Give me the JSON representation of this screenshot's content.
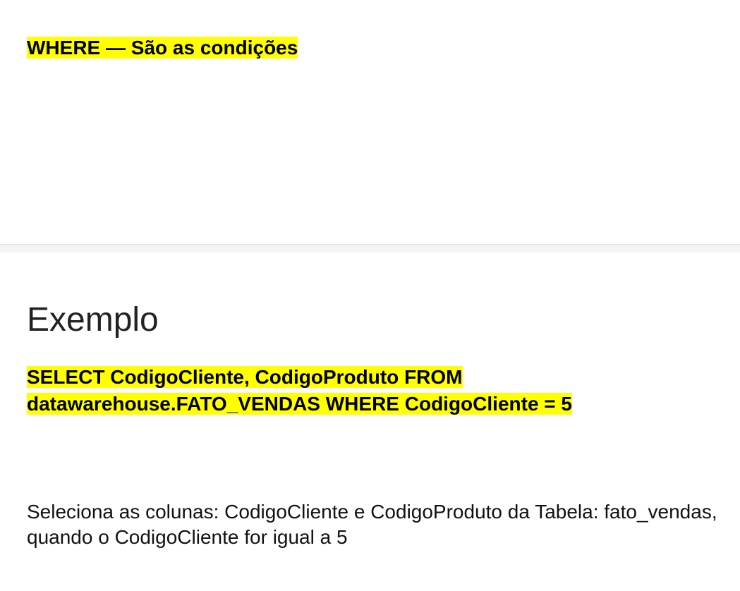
{
  "slides": [
    {
      "heading": "WHERE — São as condições"
    },
    {
      "title": "Exemplo",
      "sql": "SELECT CodigoCliente, CodigoProduto FROM datawarehouse.FATO_VENDAS WHERE CodigoCliente = 5",
      "description": "Seleciona as colunas: CodigoCliente e CodigoProduto da Tabela: fato_vendas, quando o CodigoCliente for igual a 5"
    }
  ],
  "colors": {
    "highlight": "#ffff00",
    "background": "#ffffff",
    "divider": "#f4f4f4"
  }
}
